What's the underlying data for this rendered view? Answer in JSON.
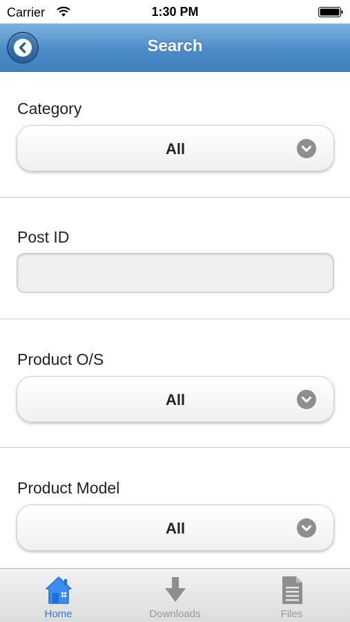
{
  "status_bar": {
    "carrier": "Carrier",
    "time": "1:30 PM",
    "wifi_icon": "wifi-icon",
    "battery_icon": "battery-icon"
  },
  "header": {
    "title": "Search",
    "back_icon": "chevron-left-icon",
    "color": "#4b8cc8"
  },
  "form": {
    "category": {
      "label": "Category",
      "value": "All"
    },
    "post_id": {
      "label": "Post ID",
      "value": "",
      "placeholder": ""
    },
    "product_os": {
      "label": "Product O/S",
      "value": "All"
    },
    "product_model": {
      "label": "Product Model",
      "value": "All"
    }
  },
  "tab_bar": {
    "active_color": "#2f7ae5",
    "inactive_color": "#9a9a9a",
    "tabs": [
      {
        "label": "Home",
        "icon": "home-icon",
        "active": true
      },
      {
        "label": "Downloads",
        "icon": "download-arrow-icon",
        "active": false
      },
      {
        "label": "Files",
        "icon": "file-icon",
        "active": false
      }
    ]
  }
}
